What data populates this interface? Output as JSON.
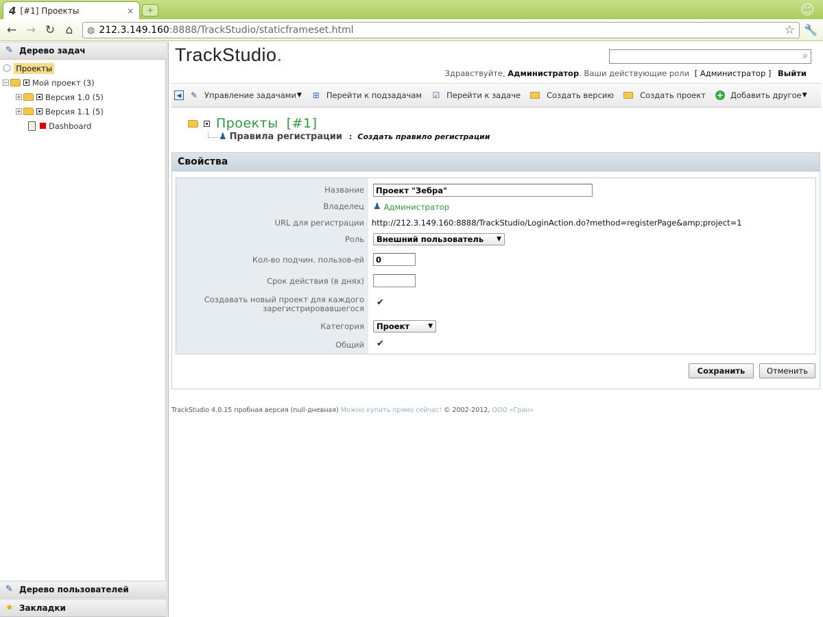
{
  "browser": {
    "tab_title": "[#1] Проекты",
    "tab_favicon": "4",
    "tab_close": "×",
    "newtab": "+",
    "url_host": "212.3.149.160",
    "url_rest": ":8888/TrackStudio/staticframeset.html",
    "icons": [
      "back-icon",
      "forward-icon",
      "reload-icon",
      "home-icon",
      "globe-icon",
      "star-icon",
      "wrench-icon"
    ]
  },
  "left_pane": {
    "task_tree_header": "Дерево задач",
    "tree": {
      "root": "Проекты",
      "items": [
        {
          "label": "Мой проект (3)"
        },
        {
          "label": "Версия 1.0 (5)"
        },
        {
          "label": "Версия 1.1 (5)"
        },
        {
          "label": "Dashboard"
        }
      ]
    },
    "users_tree_header": "Дерево пользователей",
    "bookmarks_header": "Закладки"
  },
  "header": {
    "logo": "TrackStudio",
    "logo_dot": ".",
    "greeting_prefix": "Здравствуйте,",
    "user": "Администратор",
    "roles_prefix": ". Ваши действующие роли",
    "role": "[ Администратор ]",
    "logout": "Выйти"
  },
  "actions": [
    {
      "label": "Управление задачами"
    },
    {
      "label": "Перейти к подзадачам"
    },
    {
      "label": "Перейти к задаче"
    },
    {
      "label": "Создать версию"
    },
    {
      "label": "Создать проект"
    },
    {
      "label": "Добавить другое"
    }
  ],
  "page": {
    "title": "Проекты",
    "number": "[#1]",
    "rule_name": "Правила регистрации",
    "colon": ":",
    "rule_action": "Создать правило регистрации"
  },
  "panel": {
    "title": "Свойства",
    "fields": {
      "name_label": "Название",
      "name_value": "Проект \"Зебра\"",
      "owner_label": "Владелец",
      "owner_value": "Администратор",
      "url_label": "URL для регистрации",
      "url_value": "http://212.3.149.160:8888/TrackStudio/LoginAction.do?method=registerPage&amp;project=1",
      "role_label": "Роль",
      "role_value": "Внешний пользователь",
      "count_label": "Кол-во подчин. пользов-ей",
      "count_value": "0",
      "term_label": "Срок действия (в днях)",
      "term_value": "",
      "create_project_label_1": "Создавать новый проект для каждого",
      "create_project_label_2": "зарегистрировавшегося",
      "create_project_checked": true,
      "category_label": "Категория",
      "category_value": "Проект",
      "shared_label": "Общий",
      "shared_checked": true
    },
    "save_button": "Сохранить",
    "cancel_button": "Отменить"
  },
  "footer": {
    "text": "TrackStudio 4.0.15 пробная версия (null-дневная)",
    "buy_link": "Можно купить прямо сейчас!",
    "copyright": "© 2002-2012,",
    "company": "ООО «Гран»"
  }
}
